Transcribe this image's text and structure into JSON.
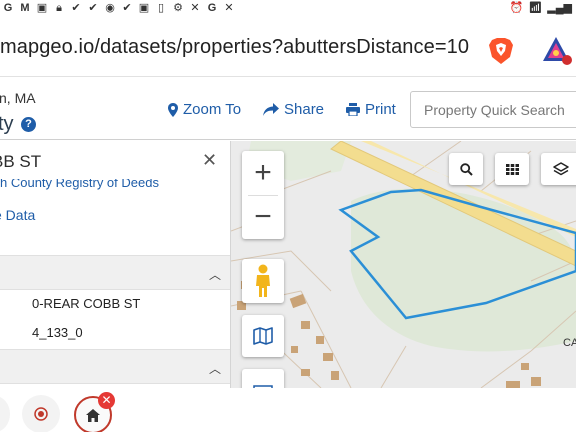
{
  "status_bar": {
    "left_icons": [
      "g-icon",
      "gmail-icon",
      "box-icon",
      "lock-icon",
      "check-icon",
      "check-icon",
      "camera-icon",
      "check-icon",
      "box-icon",
      "phone-icon",
      "settings-icon",
      "x-icon",
      "g-icon",
      "x-icon"
    ],
    "right_icons": [
      "alarm-icon",
      "wifi-icon",
      "signal-icon"
    ]
  },
  "browser": {
    "url": "mapgeo.io/datasets/properties?abuttersDistance=10"
  },
  "header": {
    "town": "n, MA",
    "title": "ty",
    "links": [
      {
        "label": "Zoom To",
        "icon": "map-pin-icon"
      },
      {
        "label": "Share",
        "icon": "share-icon"
      },
      {
        "label": "Print",
        "icon": "print-icon"
      }
    ],
    "search_placeholder": "Property Quick Search"
  },
  "panel": {
    "title": "BB ST",
    "sub_link": "h County Registry of Deeds",
    "data_link": "e Data",
    "rows": [
      {
        "value": "0-REAR COBB ST"
      },
      {
        "value": "4_133_0"
      }
    ]
  },
  "map": {
    "label": "CA",
    "parcel_outline_color": "#2b8fd6",
    "road_color": "#f3dd8f"
  },
  "colors": {
    "accent": "#1f5da8",
    "close_badge": "#e53935"
  }
}
